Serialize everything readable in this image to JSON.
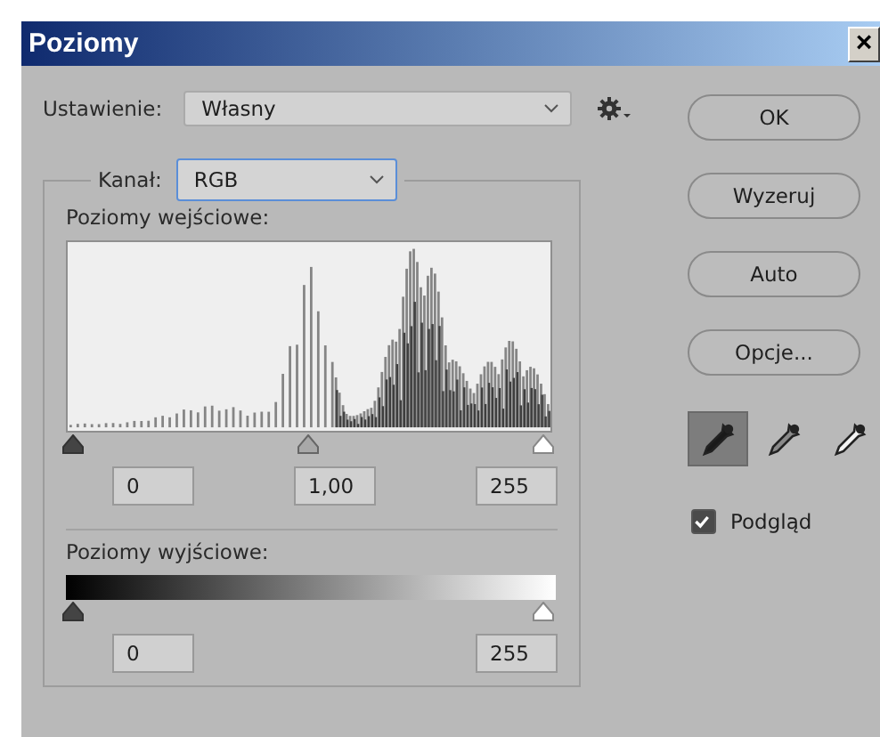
{
  "window": {
    "title": "Poziomy",
    "close": "×"
  },
  "preset": {
    "label": "Ustawienie:",
    "value": "Własny"
  },
  "channel": {
    "label": "Kanał:",
    "value": "RGB"
  },
  "input_levels": {
    "label": "Poziomy wejściowe:",
    "values": [
      "0",
      "1,00",
      "255"
    ]
  },
  "output_levels": {
    "label": "Poziomy wyjściowe:",
    "values": [
      "0",
      "255"
    ]
  },
  "buttons": [
    "OK",
    "Wyzeruj",
    "Auto",
    "Opcje..."
  ],
  "eyedroppers": [
    {
      "kind": "black",
      "selected": true
    },
    {
      "kind": "gray",
      "selected": false
    },
    {
      "kind": "white",
      "selected": false
    }
  ],
  "preview": {
    "label": "Podgląd",
    "checked": true
  }
}
